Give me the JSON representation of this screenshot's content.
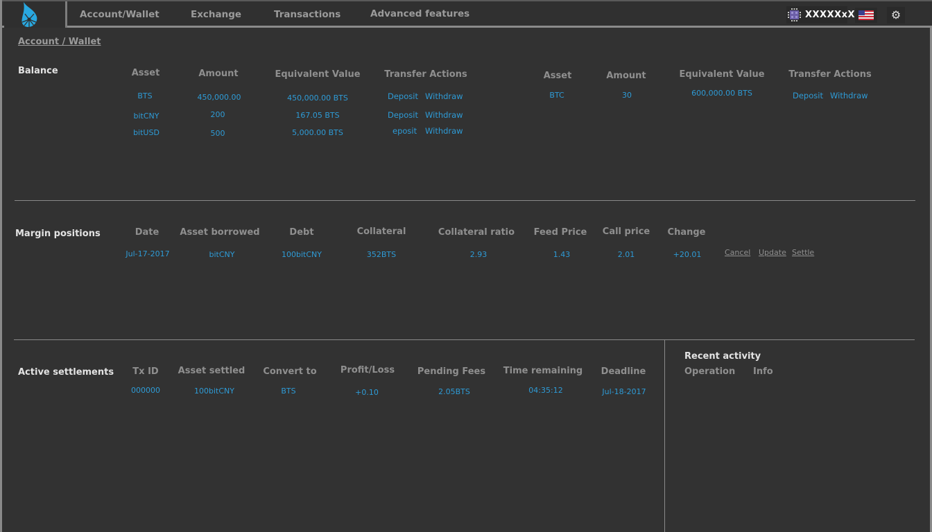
{
  "nav": {
    "items": [
      {
        "label": "Account/Wallet"
      },
      {
        "label": "Exchange"
      },
      {
        "label": "Transactions"
      },
      {
        "label": "Advanced features"
      }
    ],
    "user": {
      "name": "XXXXXxX",
      "avatar_icon": "identicon-icon"
    },
    "language_icon": "us-flag-icon",
    "settings_icon": "gear-icon"
  },
  "breadcrumb": "Account / Wallet",
  "colors": {
    "background": "#323232",
    "accent": "#2e9bd6",
    "header_text": "#8f8f8f",
    "border": "#8a8a8a"
  },
  "balance": {
    "title": "Balance",
    "headers": [
      "Asset",
      "Amount",
      "Equivalent Value",
      "Transfer Actions"
    ],
    "left_rows": [
      {
        "asset": "BTS",
        "amount": "450,000.00",
        "value": "450,000.00 BTS",
        "deposit": "Deposit",
        "withdraw": "Withdraw"
      },
      {
        "asset": "bitCNY",
        "amount": "200",
        "value": "167.05 BTS",
        "deposit": "Deposit",
        "withdraw": "Withdraw"
      },
      {
        "asset": "bitUSD",
        "amount": "500",
        "value": "5,000.00 BTS",
        "deposit": "eposit",
        "withdraw": "Withdraw"
      }
    ],
    "right_rows": [
      {
        "asset": "BTC",
        "amount": "30",
        "value": "600,000.00 BTS",
        "deposit": "Deposit",
        "withdraw": "Withdraw"
      }
    ]
  },
  "margin": {
    "title": "Margin positions",
    "headers": [
      "Date",
      "Asset borrowed",
      "Debt",
      "Collateral",
      "Collateral ratio",
      "Feed Price",
      "Call price",
      "Change"
    ],
    "rows": [
      {
        "date": "Jul-17-2017",
        "asset": "bitCNY",
        "debt": "100bitCNY",
        "collateral": "352BTS",
        "ratio": "2.93",
        "feed": "1.43",
        "call": "2.01",
        "change": "+20.01"
      }
    ],
    "actions": {
      "cancel": "Cancel",
      "update": "Update",
      "settle": "Settle"
    }
  },
  "settlements": {
    "title": "Active settlements",
    "headers": [
      "Tx ID",
      "Asset settled",
      "Convert to",
      "Profit/Loss",
      "Pending Fees",
      "Time remaining",
      "Deadline"
    ],
    "rows": [
      {
        "txid": "000000",
        "asset": "100bitCNY",
        "convert": "BTS",
        "pl": "+0.10",
        "fees": "2.05BTS",
        "time": "04:35:12",
        "deadline": "Jul-18-2017"
      }
    ]
  },
  "recent_activity": {
    "title": "Recent activity",
    "headers": [
      "Operation",
      "Info"
    ]
  }
}
